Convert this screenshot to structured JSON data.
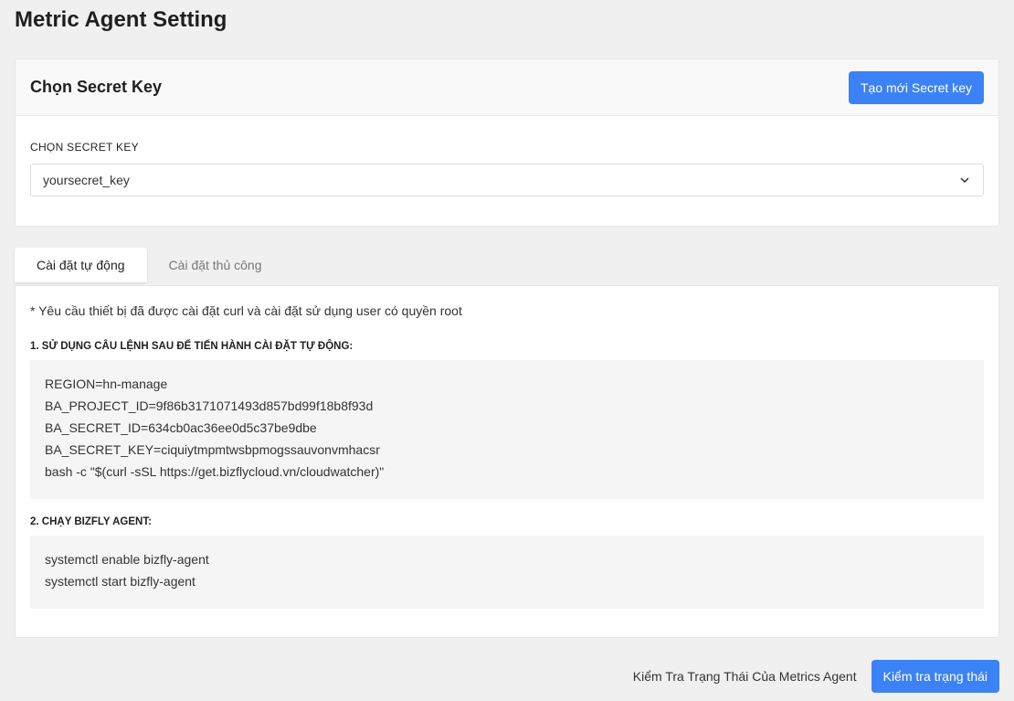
{
  "page": {
    "title": "Metric Agent Setting"
  },
  "secret_card": {
    "title": "Chọn Secret Key",
    "create_button": "Tạo mới Secret key",
    "field_label": "CHỌN SECRET KEY",
    "selected_value": "yoursecret_key"
  },
  "tabs": [
    {
      "label": "Cài đặt tự động",
      "active": true
    },
    {
      "label": "Cài đặt thủ công",
      "active": false
    }
  ],
  "auto_install": {
    "note": "* Yêu cầu thiết bị đã được cài đặt curl và cài đặt sử dụng user có quyền root",
    "step1_title": "1. SỬ DỤNG CÂU LỆNH SAU ĐỂ TIẾN HÀNH CÀI ĐẶT TỰ ĐỘNG:",
    "step1_lines": [
      "REGION=hn-manage",
      "BA_PROJECT_ID=9f86b3171071493d857bd99f18b8f93d",
      "BA_SECRET_ID=634cb0ac36ee0d5c37be9dbe",
      "BA_SECRET_KEY=ciquiytmpmtwsbpmogssauvonvmhacsr",
      "bash -c \"$(curl -sSL https://get.bizflycloud.vn/cloudwatcher)\""
    ],
    "step2_title": "2. CHẠY BIZFLY AGENT:",
    "step2_lines": [
      "systemctl enable bizfly-agent",
      "systemctl start bizfly-agent"
    ]
  },
  "footer": {
    "label": "Kiểm Tra Trạng Thái Của Metrics Agent",
    "check_button": "Kiểm tra trạng thái"
  },
  "colors": {
    "accent": "#3b82f6",
    "background": "#f0f0f0",
    "code_bg": "#f5f5f5"
  },
  "icons": {
    "select_arrow": "chevron-down-icon"
  }
}
